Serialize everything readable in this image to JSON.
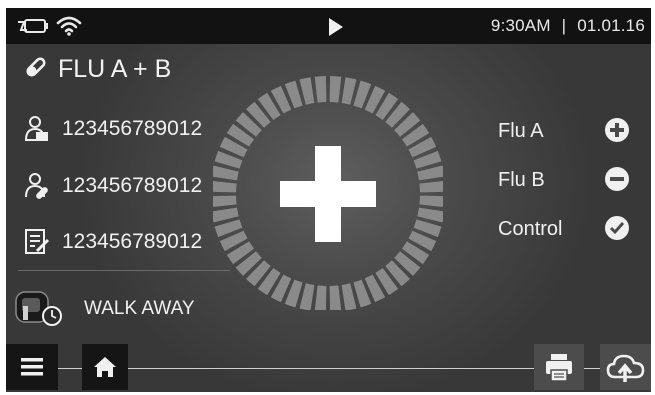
{
  "status_bar": {
    "time": "9:30AM",
    "separator": "|",
    "date": "01.01.16",
    "icons": [
      "battery-charging-icon",
      "wifi-icon",
      "play-icon"
    ]
  },
  "test": {
    "name": "FLU A + B",
    "icon": "test-strip-icon"
  },
  "info_rows": [
    {
      "icon": "patient-id-icon",
      "value": "123456789012"
    },
    {
      "icon": "operator-id-icon",
      "value": "123456789012"
    },
    {
      "icon": "record-id-icon",
      "value": "123456789012"
    }
  ],
  "mode": {
    "label": "WALK AWAY",
    "icon": "walk-away-icon"
  },
  "overall_result": {
    "icon": "positive-plus-icon",
    "ring_segments": 48
  },
  "results": [
    {
      "label": "Flu A",
      "status": "positive",
      "icon": "plus-circle-icon"
    },
    {
      "label": "Flu B",
      "status": "negative",
      "icon": "minus-circle-icon"
    },
    {
      "label": "Control",
      "status": "valid",
      "icon": "check-circle-icon"
    }
  ],
  "toolbar": {
    "menu_icon": "menu-icon",
    "home_icon": "home-icon",
    "print_icon": "print-icon",
    "upload_icon": "cloud-upload-icon"
  },
  "colors": {
    "status_bar_bg": "#121212",
    "screen_bg": "#4a4a4a",
    "ring_segment": "#8a8a8a",
    "text": "#f0f0f0"
  }
}
